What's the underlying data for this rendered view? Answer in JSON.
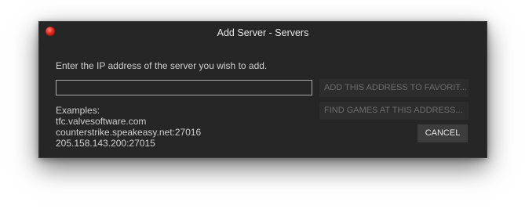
{
  "window": {
    "title": "Add Server - Servers"
  },
  "dialog": {
    "instruction": "Enter the IP address of the server you wish to add.",
    "address_input": {
      "value": "",
      "placeholder": ""
    },
    "add_favorites_label": "ADD THIS ADDRESS TO FAVORIT...",
    "find_games_label": "FIND GAMES AT THIS ADDRESS...",
    "cancel_label": "CANCEL",
    "examples_heading": "Examples:",
    "examples": [
      "tfc.valvesoftware.com",
      "counterstrike.speakeasy.net:27016",
      "205.158.143.200:27015"
    ]
  },
  "colors": {
    "window_bg": "#262626",
    "close_button": "#e0281c",
    "disabled_text": "#6d6d6d",
    "text": "#cfcfcf"
  }
}
